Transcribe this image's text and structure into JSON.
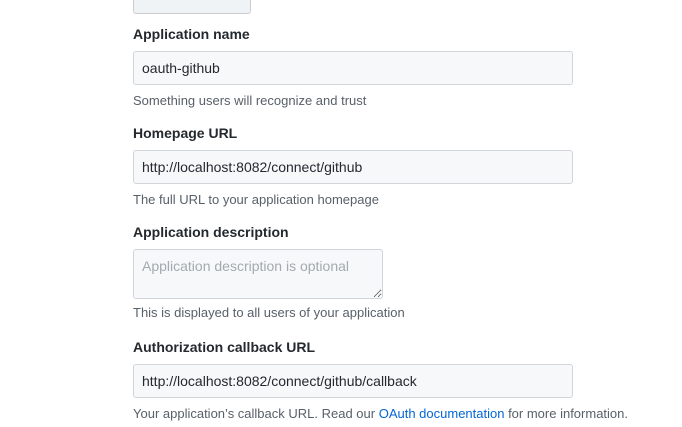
{
  "form": {
    "app_name": {
      "label": "Application name",
      "value": "oauth-github",
      "note": "Something users will recognize and trust"
    },
    "homepage": {
      "label": "Homepage URL",
      "value": "http://localhost:8082/connect/github",
      "note": "The full URL to your application homepage"
    },
    "description": {
      "label": "Application description",
      "placeholder": "Application description is optional",
      "note": "This is displayed to all users of your application"
    },
    "callback": {
      "label": "Authorization callback URL",
      "value": "http://localhost:8082/connect/github/callback",
      "note_prefix": "Your application’s callback URL. Read our ",
      "note_link": "OAuth documentation",
      "note_suffix": " for more information."
    }
  },
  "colors": {
    "link": "#0366d6",
    "input_bg": "#f6f8fa",
    "border": "#d1d5da"
  }
}
